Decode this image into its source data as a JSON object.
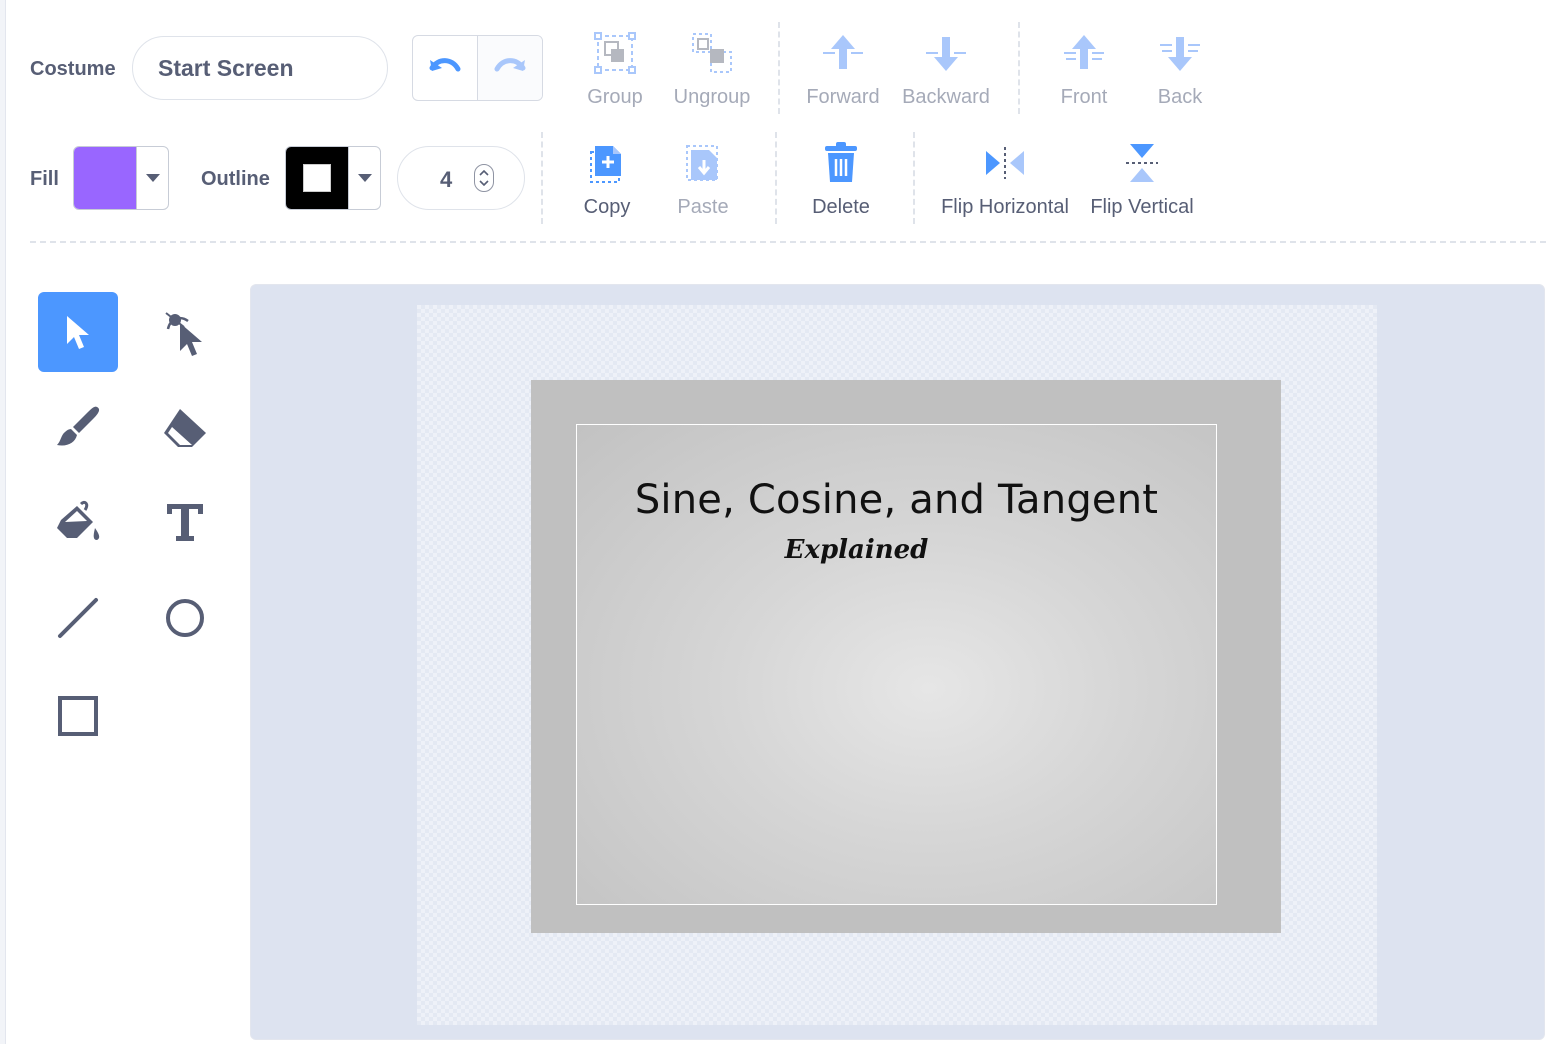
{
  "toolbar": {
    "costume_label": "Costume",
    "costume_name": "Start Screen",
    "group": "Group",
    "ungroup": "Ungroup",
    "forward": "Forward",
    "backward": "Backward",
    "front": "Front",
    "back": "Back",
    "fill_label": "Fill",
    "outline_label": "Outline",
    "outline_width": "4",
    "copy": "Copy",
    "paste": "Paste",
    "delete": "Delete",
    "flip_horizontal": "Flip Horizontal",
    "flip_vertical": "Flip Vertical"
  },
  "colors": {
    "fill": "#9966ff",
    "outline": "#000000",
    "accent": "#4c97ff",
    "disabled_icon": "#a9c7fb",
    "tool_icon": "#575e75"
  },
  "tools": [
    {
      "name": "select-tool",
      "icon": "arrow-cursor-icon",
      "selected": true
    },
    {
      "name": "reshape-tool",
      "icon": "reshape-icon",
      "selected": false
    },
    {
      "name": "brush-tool",
      "icon": "brush-icon",
      "selected": false
    },
    {
      "name": "eraser-tool",
      "icon": "eraser-icon",
      "selected": false
    },
    {
      "name": "fill-tool",
      "icon": "paint-bucket-icon",
      "selected": false
    },
    {
      "name": "text-tool",
      "icon": "text-icon",
      "selected": false
    },
    {
      "name": "line-tool",
      "icon": "line-icon",
      "selected": false
    },
    {
      "name": "circle-tool",
      "icon": "circle-icon",
      "selected": false
    },
    {
      "name": "rectangle-tool",
      "icon": "rectangle-icon",
      "selected": false
    }
  ],
  "canvas": {
    "title": "Sine, Cosine, and Tangent",
    "subtitle": "Explained"
  }
}
